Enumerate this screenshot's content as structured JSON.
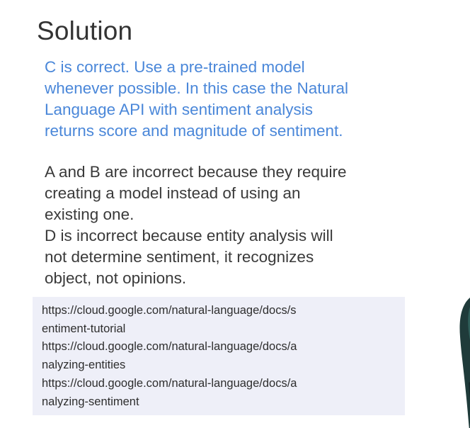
{
  "slide": {
    "title": "Solution",
    "answer_lines": [
      "C is correct. Use a pre-trained model",
      "whenever possible. In this case the Natural",
      "Language API with sentiment analysis",
      "returns score and magnitude of sentiment."
    ],
    "explanation_lines": [
      "A and B are incorrect because they require",
      "creating a model instead of using an",
      "existing one.",
      "D is incorrect because entity analysis will",
      "not determine sentiment, it recognizes",
      "object, not opinions."
    ],
    "references": [
      {
        "line1": "https://cloud.google.com/natural-language/docs/s",
        "line2": "entiment-tutorial"
      },
      {
        "line1": "https://cloud.google.com/natural-language/docs/a",
        "line2": "nalyzing-entities"
      },
      {
        "line1": "https://cloud.google.com/natural-language/docs/a",
        "line2": "nalyzing-sentiment"
      }
    ]
  },
  "colors": {
    "answer": "#4a87d9",
    "body_text": "#3a3a3a",
    "reference_background": "#eeeff8"
  }
}
